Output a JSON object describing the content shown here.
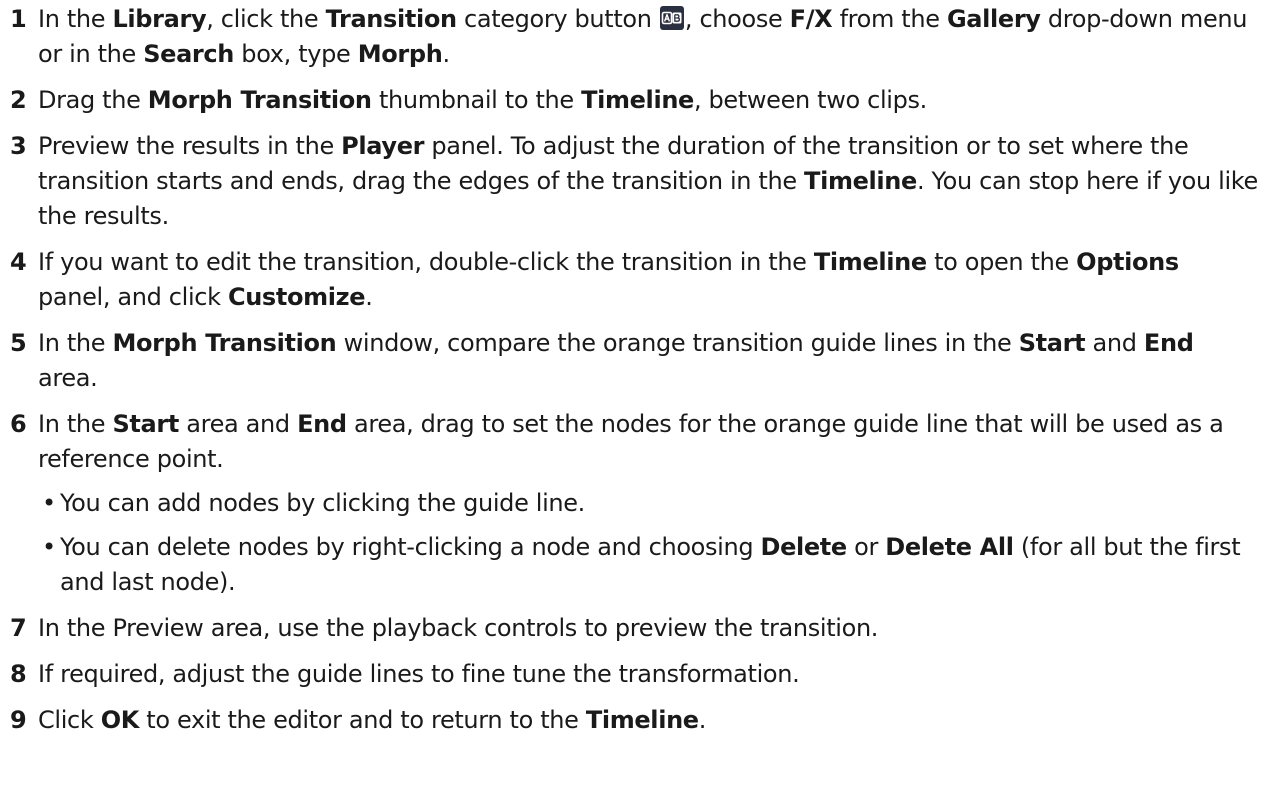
{
  "steps": [
    {
      "number": "1",
      "segments": [
        {
          "t": "In the "
        },
        {
          "t": "Library",
          "b": true
        },
        {
          "t": ", click the "
        },
        {
          "t": "Transition",
          "b": true
        },
        {
          "t": " category button "
        },
        {
          "icon": "transition-category-icon"
        },
        {
          "t": ", choose "
        },
        {
          "t": "F/X",
          "b": true
        },
        {
          "t": " from the "
        },
        {
          "t": "Gallery",
          "b": true
        },
        {
          "t": " drop-down menu or in the "
        },
        {
          "t": "Search",
          "b": true
        },
        {
          "t": " box, type "
        },
        {
          "t": "Morph",
          "b": true
        },
        {
          "t": "."
        }
      ]
    },
    {
      "number": "2",
      "segments": [
        {
          "t": "Drag the "
        },
        {
          "t": "Morph Transition",
          "b": true
        },
        {
          "t": " thumbnail to the "
        },
        {
          "t": "Timeline",
          "b": true
        },
        {
          "t": ", between two clips."
        }
      ]
    },
    {
      "number": "3",
      "segments": [
        {
          "t": "Preview the results in the "
        },
        {
          "t": "Player",
          "b": true
        },
        {
          "t": " panel. To adjust the duration of the transition or to set where the transition starts and ends, drag the edges of the transition in the "
        },
        {
          "t": "Timeline",
          "b": true
        },
        {
          "t": ". You can stop here if you like the results."
        }
      ]
    },
    {
      "number": "4",
      "segments": [
        {
          "t": "If you want to edit the transition, double-click the transition in the "
        },
        {
          "t": "Timeline",
          "b": true
        },
        {
          "t": " to open the "
        },
        {
          "t": "Options",
          "b": true
        },
        {
          "t": " panel, and click "
        },
        {
          "t": "Customize",
          "b": true
        },
        {
          "t": "."
        }
      ]
    },
    {
      "number": "5",
      "segments": [
        {
          "t": "In the "
        },
        {
          "t": "Morph Transition",
          "b": true
        },
        {
          "t": " window, compare the orange transition guide lines in the "
        },
        {
          "t": "Start",
          "b": true
        },
        {
          "t": " and "
        },
        {
          "t": "End",
          "b": true
        },
        {
          "t": " area."
        }
      ]
    },
    {
      "number": "6",
      "segments": [
        {
          "t": "In the "
        },
        {
          "t": "Start",
          "b": true
        },
        {
          "t": " area and "
        },
        {
          "t": "End",
          "b": true
        },
        {
          "t": " area, drag to set the nodes for the orange guide line that will be used as a reference point."
        }
      ],
      "bullets": [
        {
          "marker": "•",
          "segments": [
            {
              "t": "You can add nodes by clicking the guide line."
            }
          ]
        },
        {
          "marker": "•",
          "segments": [
            {
              "t": "You can delete nodes by right-clicking a node and choosing "
            },
            {
              "t": "Delete",
              "b": true
            },
            {
              "t": " or "
            },
            {
              "t": "Delete All",
              "b": true
            },
            {
              "t": " (for all but the first and last node)."
            }
          ]
        }
      ]
    },
    {
      "number": "7",
      "segments": [
        {
          "t": "In the Preview area, use the playback controls to preview the transition."
        }
      ]
    },
    {
      "number": "8",
      "segments": [
        {
          "t": "If required, adjust the guide lines to fine tune the transformation."
        }
      ]
    },
    {
      "number": "9",
      "segments": [
        {
          "t": "Click "
        },
        {
          "t": "OK",
          "b": true
        },
        {
          "t": " to exit the editor and to return to the "
        },
        {
          "t": "Timeline",
          "b": true
        },
        {
          "t": "."
        }
      ]
    }
  ],
  "colors": {
    "text": "#1a1a1a",
    "icon_background": "#2b3040",
    "icon_foreground": "#ffffff"
  }
}
